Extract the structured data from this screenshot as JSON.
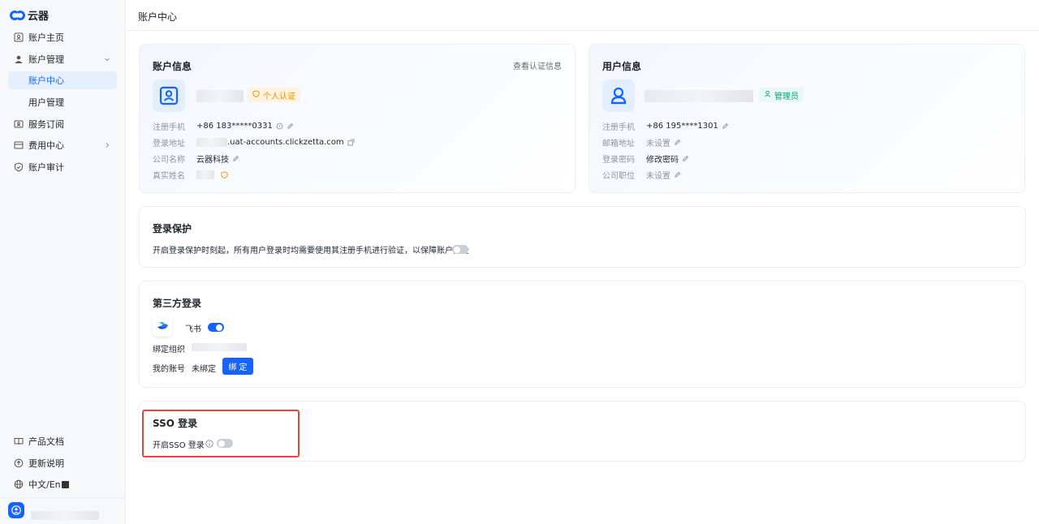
{
  "app": {
    "logo_text": "云器",
    "brand_color": "#1664ff"
  },
  "sidebar": {
    "items": [
      {
        "label": "账户主页",
        "icon": "home-icon"
      },
      {
        "label": "账户管理",
        "icon": "user-icon",
        "expanded": true
      },
      {
        "label": "账户中心",
        "active": true
      },
      {
        "label": "用户管理"
      },
      {
        "label": "服务订阅",
        "icon": "subscription-icon"
      },
      {
        "label": "费用中心",
        "icon": "billing-icon",
        "has_children": true
      },
      {
        "label": "账户审计",
        "icon": "shield-icon"
      }
    ],
    "bottom": [
      {
        "label": "产品文档",
        "icon": "book-icon"
      },
      {
        "label": "更新说明",
        "icon": "update-icon"
      },
      {
        "label": "中文/En",
        "icon": "globe-icon"
      }
    ]
  },
  "header": {
    "title": "账户中心"
  },
  "account_info": {
    "title": "账户信息",
    "view_cert_link": "查看认证信息",
    "cert_badge": "个人认证",
    "fields": [
      {
        "label": "注册手机",
        "value": "+86 183*****0331"
      },
      {
        "label": "登录地址",
        "value": ".uat-accounts.clickzetta.com"
      },
      {
        "label": "公司名称",
        "value": "云器科技"
      },
      {
        "label": "真实姓名",
        "value": ""
      }
    ]
  },
  "user_info": {
    "title": "用户信息",
    "role_badge": "管理员",
    "fields": [
      {
        "label": "注册手机",
        "value": "+86 195****1301"
      },
      {
        "label": "邮箱地址",
        "value": "未设置"
      },
      {
        "label": "登录密码",
        "value": "修改密码"
      },
      {
        "label": "公司职位",
        "value": "未设置"
      }
    ]
  },
  "login_protection": {
    "title": "登录保护",
    "description": "开启登录保护时刻起，所有用户登录时均需要使用其注册手机进行验证，以保障账户安全",
    "enabled": false
  },
  "third_party": {
    "title": "第三方登录",
    "provider": "飞书",
    "enabled": true,
    "org_label": "绑定组织",
    "account_label": "我的账号",
    "account_status": "未绑定",
    "bind_button": "绑定"
  },
  "sso": {
    "title": "SSO 登录",
    "toggle_label": "开启SSO 登录",
    "enabled": false
  }
}
